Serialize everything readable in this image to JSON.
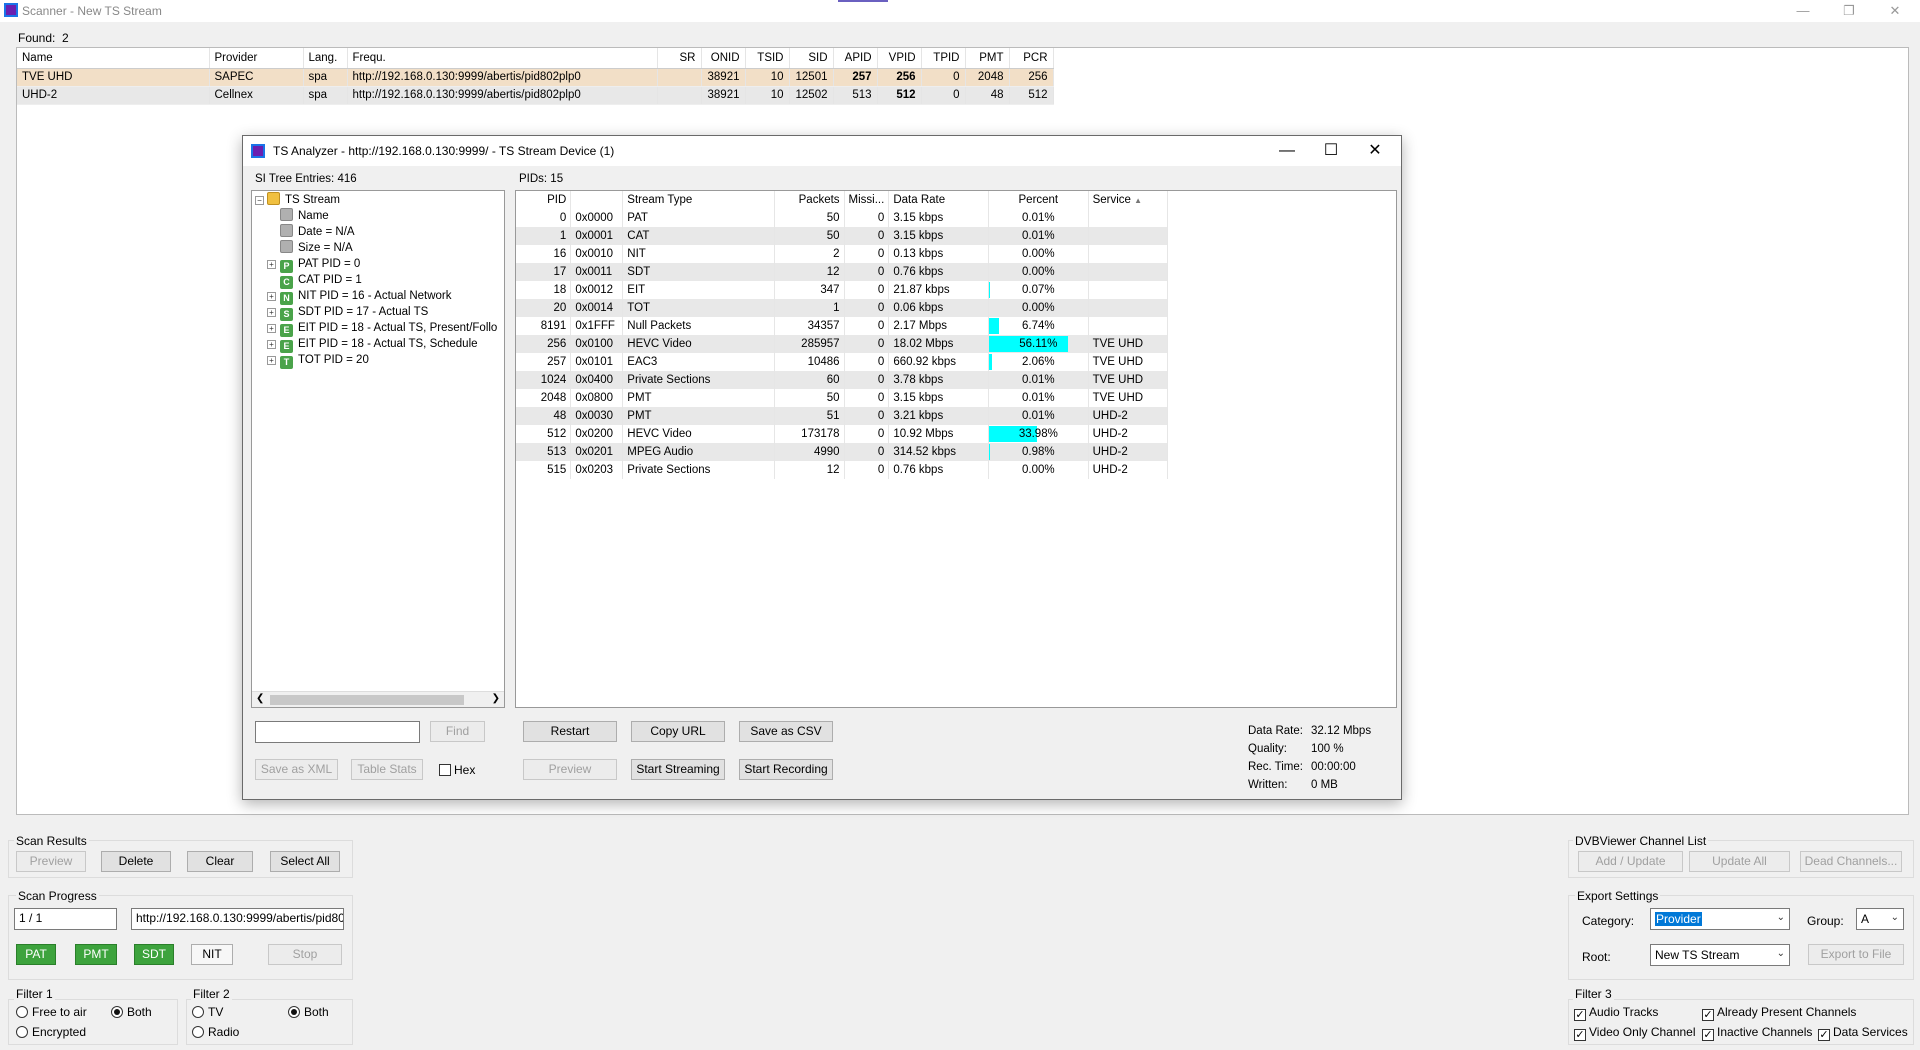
{
  "app": {
    "title": "Scanner - New TS Stream",
    "found_label": "Found:",
    "found_count": "2"
  },
  "scan_table": {
    "columns": [
      "Name",
      "Provider",
      "Lang.",
      "Frequ.",
      "SR",
      "ONID",
      "TSID",
      "SID",
      "APID",
      "VPID",
      "TPID",
      "PMT",
      "PCR"
    ],
    "rows": [
      [
        "TVE UHD",
        "SAPEC",
        "spa",
        "http://192.168.0.130:9999/abertis/pid802plp0",
        "",
        "38921",
        "10",
        "12501",
        "257",
        "256",
        "0",
        "2048",
        "256"
      ],
      [
        "UHD-2",
        "Cellnex",
        "spa",
        "http://192.168.0.130:9999/abertis/pid802plp0",
        "",
        "38921",
        "10",
        "12502",
        "513",
        "512",
        "0",
        "48",
        "512"
      ]
    ]
  },
  "analyzer": {
    "title": "TS Analyzer - http://192.168.0.130:9999/ - TS Stream Device (1)",
    "si_label": "SI Tree Entries: 416",
    "pids_label": "PIDs: 15",
    "tree": [
      {
        "label": "TS Stream",
        "icon": "folder-icon"
      },
      {
        "label": "Name",
        "icon": "leaf-icon"
      },
      {
        "label": "Date = N/A",
        "icon": "leaf-icon"
      },
      {
        "label": "Size = N/A",
        "icon": "leaf-icon"
      },
      {
        "label": "PAT PID = 0",
        "icon": "P"
      },
      {
        "label": "CAT PID = 1",
        "icon": "C"
      },
      {
        "label": "NIT PID = 16 - Actual Network",
        "icon": "N"
      },
      {
        "label": "SDT PID = 17 - Actual TS",
        "icon": "S"
      },
      {
        "label": "EIT PID = 18 - Actual TS, Present/Follo",
        "icon": "E"
      },
      {
        "label": "EIT PID = 18 - Actual TS, Schedule",
        "icon": "E"
      },
      {
        "label": "TOT PID = 20",
        "icon": "T"
      }
    ],
    "pid_columns": [
      "PID",
      "",
      "Stream Type",
      "Packets",
      "Missi...",
      "Data Rate",
      "Percent",
      "Service"
    ],
    "pids": [
      {
        "pid": "0",
        "hex": "0x0000",
        "type": "PAT",
        "packets": "50",
        "missing": "0",
        "rate": "3.15 kbps",
        "percent": "0.01%",
        "pct": 0.01,
        "service": ""
      },
      {
        "pid": "1",
        "hex": "0x0001",
        "type": "CAT",
        "packets": "50",
        "missing": "0",
        "rate": "3.15 kbps",
        "percent": "0.01%",
        "pct": 0.01,
        "service": ""
      },
      {
        "pid": "16",
        "hex": "0x0010",
        "type": "NIT",
        "packets": "2",
        "missing": "0",
        "rate": "0.13 kbps",
        "percent": "0.00%",
        "pct": 0,
        "service": ""
      },
      {
        "pid": "17",
        "hex": "0x0011",
        "type": "SDT",
        "packets": "12",
        "missing": "0",
        "rate": "0.76 kbps",
        "percent": "0.00%",
        "pct": 0,
        "service": ""
      },
      {
        "pid": "18",
        "hex": "0x0012",
        "type": "EIT",
        "packets": "347",
        "missing": "0",
        "rate": "21.87 kbps",
        "percent": "0.07%",
        "pct": 0.07,
        "service": ""
      },
      {
        "pid": "20",
        "hex": "0x0014",
        "type": "TOT",
        "packets": "1",
        "missing": "0",
        "rate": "0.06 kbps",
        "percent": "0.00%",
        "pct": 0,
        "service": ""
      },
      {
        "pid": "8191",
        "hex": "0x1FFF",
        "type": "Null Packets",
        "packets": "34357",
        "missing": "0",
        "rate": "2.17 Mbps",
        "percent": "6.74%",
        "pct": 6.74,
        "service": ""
      },
      {
        "pid": "256",
        "hex": "0x0100",
        "type": "HEVC Video",
        "packets": "285957",
        "missing": "0",
        "rate": "18.02 Mbps",
        "percent": "56.11%",
        "pct": 56.11,
        "service": "TVE UHD"
      },
      {
        "pid": "257",
        "hex": "0x0101",
        "type": "EAC3",
        "packets": "10486",
        "missing": "0",
        "rate": "660.92 kbps",
        "percent": "2.06%",
        "pct": 2.06,
        "service": "TVE UHD"
      },
      {
        "pid": "1024",
        "hex": "0x0400",
        "type": "Private Sections",
        "packets": "60",
        "missing": "0",
        "rate": "3.78 kbps",
        "percent": "0.01%",
        "pct": 0.01,
        "service": "TVE UHD"
      },
      {
        "pid": "2048",
        "hex": "0x0800",
        "type": "PMT",
        "packets": "50",
        "missing": "0",
        "rate": "3.15 kbps",
        "percent": "0.01%",
        "pct": 0.01,
        "service": "TVE UHD"
      },
      {
        "pid": "48",
        "hex": "0x0030",
        "type": "PMT",
        "packets": "51",
        "missing": "0",
        "rate": "3.21 kbps",
        "percent": "0.01%",
        "pct": 0.01,
        "service": "UHD-2"
      },
      {
        "pid": "512",
        "hex": "0x0200",
        "type": "HEVC Video",
        "packets": "173178",
        "missing": "0",
        "rate": "10.92 Mbps",
        "percent": "33.98%",
        "pct": 33.98,
        "service": "UHD-2"
      },
      {
        "pid": "513",
        "hex": "0x0201",
        "type": "MPEG Audio",
        "packets": "4990",
        "missing": "0",
        "rate": "314.52 kbps",
        "percent": "0.98%",
        "pct": 0.98,
        "service": "UHD-2"
      },
      {
        "pid": "515",
        "hex": "0x0203",
        "type": "Private Sections",
        "packets": "12",
        "missing": "0",
        "rate": "0.76 kbps",
        "percent": "0.00%",
        "pct": 0,
        "service": "UHD-2"
      }
    ],
    "buttons": {
      "find": "Find",
      "save_xml": "Save as XML",
      "table_stats": "Table Stats",
      "hex": "Hex",
      "restart": "Restart",
      "copy_url": "Copy URL",
      "save_csv": "Save as CSV",
      "preview": "Preview",
      "start_streaming": "Start Streaming",
      "start_recording": "Start Recording"
    },
    "stats": {
      "data_rate_label": "Data Rate:",
      "data_rate": "32.12 Mbps",
      "quality_label": "Quality:",
      "quality": "100 %",
      "rec_time_label": "Rec. Time:",
      "rec_time": "00:00:00",
      "written_label": "Written:",
      "written": "0 MB"
    }
  },
  "scan_results": {
    "label": "Scan Results",
    "preview": "Preview",
    "delete": "Delete",
    "clear": "Clear",
    "select_all": "Select All"
  },
  "scan_progress": {
    "label": "Scan Progress",
    "count": "1 / 1",
    "url": "http://192.168.0.130:9999/abertis/pid80",
    "pat": "PAT",
    "pmt": "PMT",
    "sdt": "SDT",
    "nit": "NIT",
    "stop": "Stop"
  },
  "filter1": {
    "label": "Filter 1",
    "free": "Free to air",
    "encrypted": "Encrypted",
    "both": "Both"
  },
  "filter2": {
    "label": "Filter 2",
    "tv": "TV",
    "radio": "Radio",
    "both": "Both"
  },
  "channel_list": {
    "label": "DVBViewer Channel List",
    "add": "Add / Update",
    "update_all": "Update All",
    "dead": "Dead Channels..."
  },
  "export": {
    "label": "Export Settings",
    "category_label": "Category:",
    "category": "Provider",
    "group_label": "Group:",
    "group": "A",
    "root_label": "Root:",
    "root": "New TS Stream",
    "export_btn": "Export to File"
  },
  "filter3": {
    "label": "Filter 3",
    "audio": "Audio Tracks",
    "present": "Already Present Channels",
    "video_only": "Video Only Channel",
    "inactive": "Inactive Channels",
    "data": "Data Services"
  }
}
